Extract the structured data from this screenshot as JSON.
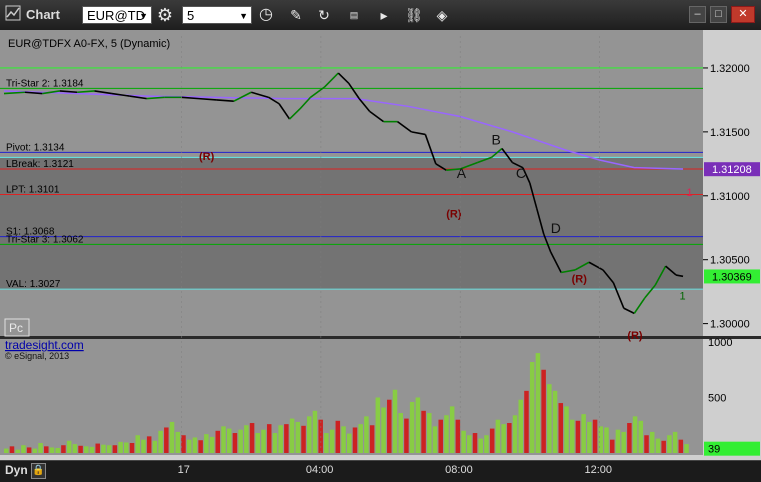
{
  "titlebar": {
    "title": "Chart",
    "symbol_value": "EUR@TD",
    "interval_value": "5",
    "icons": [
      "chart-icon",
      "symbol-dropdown",
      "settings-gear-icon",
      "interval-dropdown",
      "clock-icon",
      "pencil-draw-icon",
      "refresh-icon",
      "gsi-icon",
      "play-icon",
      "link-icon",
      "diamond-tools-icon",
      "minimize-icon",
      "restore-icon",
      "close-icon"
    ]
  },
  "bottombar": {
    "label": "Dyn",
    "icon": "lock-icon"
  },
  "colors": {
    "plot_bg": "#949494",
    "value_area": "#737373",
    "axis_bg": "#cfcfcf",
    "up_candle": "#008000",
    "down_candle": "#000000",
    "cyan_line": "#66dddd",
    "blue_line": "#2222cc",
    "red_line": "#dd2222",
    "green_line": "#00aa00",
    "bright_green": "#33ee33",
    "moving_avg": "#9966ff",
    "volume_up": "#88cc44",
    "volume_down": "#cc2222",
    "magenta": "#ff33ff"
  },
  "chart_data": {
    "type": "line",
    "title": "EUR@TDFX A0-FX, 5 (Dynamic)",
    "price_axis": {
      "ylim": [
        1.2995,
        1.3225
      ],
      "ticks": [
        "1.32000",
        "1.31500",
        "1.31000",
        "1.30500",
        "1.30000"
      ],
      "tick_values": [
        1.32,
        1.315,
        1.31,
        1.305,
        1.3
      ]
    },
    "time_axis": {
      "ticks": [
        "17",
        "04:00",
        "08:00",
        "12:00"
      ],
      "tick_hours": [
        0,
        4,
        8,
        12
      ],
      "xlim_hours": [
        -5.1,
        14.6
      ]
    },
    "last_price_badges": [
      {
        "value": 1.30369,
        "label": "1.30369"
      },
      {
        "value": 1.31208,
        "label": "1.31208"
      }
    ],
    "levels": [
      {
        "label": "Tri-Star 2: 1.3184",
        "value": 1.3184,
        "kind": "green"
      },
      {
        "label": "Pivot: 1.3134",
        "value": 1.3134,
        "kind": "blue"
      },
      {
        "label": "LBreak: 1.3121",
        "value": 1.3121,
        "kind": "red"
      },
      {
        "label": "LPT: 1.3101",
        "value": 1.3101,
        "kind": "red"
      },
      {
        "label": "S1: 1.3068",
        "value": 1.3068,
        "kind": "blue"
      },
      {
        "label": "Tri-Star 3: 1.3062",
        "value": 1.3062,
        "kind": "green"
      },
      {
        "label": "VAL: 1.3027",
        "value": 1.3027,
        "kind": "cyan"
      }
    ],
    "extra_lines": [
      {
        "value": 1.32,
        "kind": "bright_green"
      },
      {
        "value": 1.313,
        "kind": "cyan"
      }
    ],
    "value_area": {
      "from": 1.3027,
      "to": 1.313
    },
    "close_series": [
      {
        "x": -5.1,
        "y": 1.318
      },
      {
        "x": -4.5,
        "y": 1.3181
      },
      {
        "x": -4.0,
        "y": 1.318
      },
      {
        "x": -3.5,
        "y": 1.3182
      },
      {
        "x": -3.0,
        "y": 1.3181
      },
      {
        "x": -2.5,
        "y": 1.3182
      },
      {
        "x": -2.0,
        "y": 1.318
      },
      {
        "x": -1.5,
        "y": 1.3178
      },
      {
        "x": -1.0,
        "y": 1.3176
      },
      {
        "x": -0.5,
        "y": 1.3177
      },
      {
        "x": 0.0,
        "y": 1.3177
      },
      {
        "x": 0.5,
        "y": 1.3176
      },
      {
        "x": 1.0,
        "y": 1.3175
      },
      {
        "x": 1.5,
        "y": 1.3174
      },
      {
        "x": 2.0,
        "y": 1.3181
      },
      {
        "x": 2.5,
        "y": 1.3177
      },
      {
        "x": 2.8,
        "y": 1.3172
      },
      {
        "x": 3.1,
        "y": 1.316
      },
      {
        "x": 3.4,
        "y": 1.3168
      },
      {
        "x": 3.7,
        "y": 1.3177
      },
      {
        "x": 4.1,
        "y": 1.3185
      },
      {
        "x": 4.5,
        "y": 1.3196
      },
      {
        "x": 4.8,
        "y": 1.3188
      },
      {
        "x": 5.1,
        "y": 1.3176
      },
      {
        "x": 5.4,
        "y": 1.3166
      },
      {
        "x": 5.8,
        "y": 1.3158
      },
      {
        "x": 6.2,
        "y": 1.3158
      },
      {
        "x": 6.6,
        "y": 1.315
      },
      {
        "x": 7.0,
        "y": 1.3148
      },
      {
        "x": 7.3,
        "y": 1.3125
      },
      {
        "x": 7.6,
        "y": 1.312
      },
      {
        "x": 8.0,
        "y": 1.3121
      },
      {
        "x": 8.5,
        "y": 1.3126
      },
      {
        "x": 8.9,
        "y": 1.313
      },
      {
        "x": 9.2,
        "y": 1.3137
      },
      {
        "x": 9.5,
        "y": 1.3126
      },
      {
        "x": 9.8,
        "y": 1.3122
      },
      {
        "x": 10.0,
        "y": 1.311
      },
      {
        "x": 10.2,
        "y": 1.309
      },
      {
        "x": 10.4,
        "y": 1.307
      },
      {
        "x": 10.6,
        "y": 1.3056
      },
      {
        "x": 10.9,
        "y": 1.304
      },
      {
        "x": 11.3,
        "y": 1.3042
      },
      {
        "x": 11.7,
        "y": 1.3048
      },
      {
        "x": 12.1,
        "y": 1.3042
      },
      {
        "x": 12.4,
        "y": 1.3032
      },
      {
        "x": 12.7,
        "y": 1.3012
      },
      {
        "x": 13.0,
        "y": 1.3008
      },
      {
        "x": 13.3,
        "y": 1.302
      },
      {
        "x": 13.6,
        "y": 1.303
      },
      {
        "x": 13.9,
        "y": 1.3045
      },
      {
        "x": 14.2,
        "y": 1.3038
      },
      {
        "x": 14.4,
        "y": 1.3037
      }
    ],
    "moving_average": [
      {
        "x": -5.1,
        "y": 1.3182
      },
      {
        "x": -1.0,
        "y": 1.3178
      },
      {
        "x": 1.0,
        "y": 1.3177
      },
      {
        "x": 3.0,
        "y": 1.3176
      },
      {
        "x": 5.0,
        "y": 1.3176
      },
      {
        "x": 6.5,
        "y": 1.317
      },
      {
        "x": 8.0,
        "y": 1.3162
      },
      {
        "x": 9.5,
        "y": 1.315
      },
      {
        "x": 11.0,
        "y": 1.3136
      },
      {
        "x": 12.0,
        "y": 1.3128
      },
      {
        "x": 13.0,
        "y": 1.3122
      },
      {
        "x": 14.4,
        "y": 1.3121
      }
    ],
    "annotations": [
      {
        "text": "A",
        "x": 7.9,
        "y": 1.3114
      },
      {
        "text": "B",
        "x": 8.9,
        "y": 1.314
      },
      {
        "text": "C",
        "x": 9.6,
        "y": 1.3114
      },
      {
        "text": "D",
        "x": 10.6,
        "y": 1.3071
      },
      {
        "text": "(R)",
        "x": 0.5,
        "y": 1.3128
      },
      {
        "text": "(R)",
        "x": 7.6,
        "y": 1.3083
      },
      {
        "text": "(R)",
        "x": 11.2,
        "y": 1.3032
      },
      {
        "text": "(R)",
        "x": 12.8,
        "y": 1.2988
      },
      {
        "text": "1",
        "x": 14.3,
        "y": 1.3019
      },
      {
        "text": "1",
        "x": 14.5,
        "y": 1.31
      }
    ],
    "volume_axis": {
      "ylim": [
        0,
        1000
      ],
      "ticks": [
        "1000",
        "500"
      ],
      "tick_values": [
        1000,
        500
      ],
      "current": 39,
      "current_label": "39"
    },
    "volume": [
      40,
      60,
      30,
      70,
      50,
      40,
      90,
      60,
      50,
      45,
      70,
      110,
      80,
      65,
      60,
      55,
      85,
      75,
      70,
      70,
      100,
      95,
      90,
      160,
      120,
      150,
      110,
      200,
      230,
      280,
      190,
      160,
      120,
      140,
      115,
      170,
      145,
      200,
      240,
      220,
      180,
      210,
      250,
      270,
      180,
      210,
      260,
      180,
      250,
      260,
      310,
      280,
      245,
      330,
      380,
      300,
      180,
      210,
      290,
      240,
      175,
      230,
      260,
      330,
      250,
      500,
      410,
      480,
      570,
      360,
      310,
      460,
      500,
      380,
      360,
      240,
      300,
      340,
      420,
      300,
      200,
      160,
      180,
      130,
      160,
      220,
      300,
      260,
      270,
      340,
      480,
      560,
      820,
      900,
      750,
      620,
      560,
      450,
      420,
      300,
      290,
      350,
      280,
      300,
      240,
      230,
      120,
      210,
      190,
      270,
      330,
      290,
      160,
      190,
      130,
      110,
      160,
      190,
      120,
      80
    ],
    "brand": {
      "badge": "Pc",
      "link": "tradesight.com",
      "copyright": "© eSignal, 2013"
    }
  }
}
